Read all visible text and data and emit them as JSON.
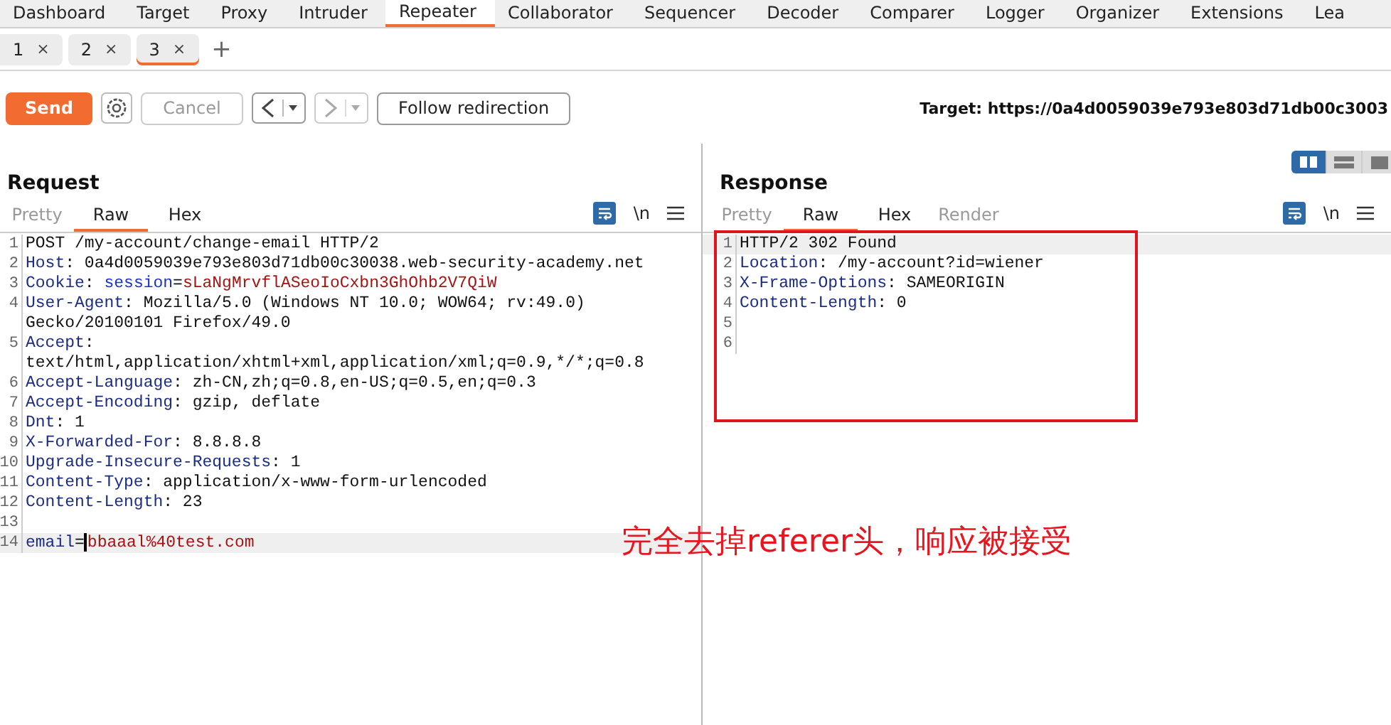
{
  "main_tabs": [
    {
      "label": "Dashboard",
      "selected": false
    },
    {
      "label": "Target",
      "selected": false
    },
    {
      "label": "Proxy",
      "selected": false
    },
    {
      "label": "Intruder",
      "selected": false
    },
    {
      "label": "Repeater",
      "selected": true
    },
    {
      "label": "Collaborator",
      "selected": false
    },
    {
      "label": "Sequencer",
      "selected": false
    },
    {
      "label": "Decoder",
      "selected": false
    },
    {
      "label": "Comparer",
      "selected": false
    },
    {
      "label": "Logger",
      "selected": false
    },
    {
      "label": "Organizer",
      "selected": false
    },
    {
      "label": "Extensions",
      "selected": false
    },
    {
      "label": "Lea",
      "selected": false
    }
  ],
  "request_tabs": [
    {
      "label": "1",
      "close": "×",
      "selected": false
    },
    {
      "label": "2",
      "close": "×",
      "selected": false
    },
    {
      "label": "3",
      "close": "×",
      "selected": true
    }
  ],
  "add_tab": "+",
  "toolbar": {
    "send": "Send",
    "cancel": "Cancel",
    "follow": "Follow redirection",
    "target": "Target: https://0a4d0059039e793e803d71db00c3003"
  },
  "request": {
    "title": "Request",
    "tabs": [
      {
        "label": "Pretty",
        "selected": false,
        "disabled": true
      },
      {
        "label": "Raw",
        "selected": true,
        "disabled": false
      },
      {
        "label": "Hex",
        "selected": false,
        "disabled": false
      }
    ],
    "newline": "\\n",
    "lines": [
      {
        "number": "1",
        "current": false,
        "parts": [
          {
            "kind": "plain",
            "text": "POST /my-account/change-email HTTP/2"
          }
        ]
      },
      {
        "number": "2",
        "current": false,
        "parts": [
          {
            "kind": "name",
            "text": "Host"
          },
          {
            "kind": "plain",
            "text": ": 0a4d0059039e793e803d71db00c30038.web-security-academy.net"
          }
        ]
      },
      {
        "number": "3",
        "current": false,
        "parts": [
          {
            "kind": "name",
            "text": "Cookie"
          },
          {
            "kind": "plain",
            "text": ": "
          },
          {
            "kind": "param",
            "text": "session"
          },
          {
            "kind": "plain",
            "text": "="
          },
          {
            "kind": "value",
            "text": "sLaNgMrvflASeoIoCxbn3GhOhb2V7QiW"
          }
        ]
      },
      {
        "number": "4",
        "current": false,
        "parts": [
          {
            "kind": "name",
            "text": "User-Agent"
          },
          {
            "kind": "plain",
            "text": ": Mozilla/5.0 (Windows NT 10.0; WOW64; rv:49.0)"
          }
        ]
      },
      {
        "current": false,
        "parts": [
          {
            "kind": "plain",
            "text": "Gecko/20100101 Firefox/49.0"
          }
        ]
      },
      {
        "number": "5",
        "current": false,
        "parts": [
          {
            "kind": "name",
            "text": "Accept"
          },
          {
            "kind": "plain",
            "text": ":"
          }
        ]
      },
      {
        "current": false,
        "parts": [
          {
            "kind": "plain",
            "text": "text/html,application/xhtml+xml,application/xml;q=0.9,*/*;q=0.8"
          }
        ]
      },
      {
        "number": "6",
        "current": false,
        "parts": [
          {
            "kind": "name",
            "text": "Accept-Language"
          },
          {
            "kind": "plain",
            "text": ": zh-CN,zh;q=0.8,en-US;q=0.5,en;q=0.3"
          }
        ]
      },
      {
        "number": "7",
        "current": false,
        "parts": [
          {
            "kind": "name",
            "text": "Accept-Encoding"
          },
          {
            "kind": "plain",
            "text": ": gzip, deflate"
          }
        ]
      },
      {
        "number": "8",
        "current": false,
        "parts": [
          {
            "kind": "name",
            "text": "Dnt"
          },
          {
            "kind": "plain",
            "text": ": 1"
          }
        ]
      },
      {
        "number": "9",
        "current": false,
        "parts": [
          {
            "kind": "name",
            "text": "X-Forwarded-For"
          },
          {
            "kind": "plain",
            "text": ": 8.8.8.8"
          }
        ]
      },
      {
        "number": "10",
        "current": false,
        "parts": [
          {
            "kind": "name",
            "text": "Upgrade-Insecure-Requests"
          },
          {
            "kind": "plain",
            "text": ": 1"
          }
        ]
      },
      {
        "number": "11",
        "current": false,
        "parts": [
          {
            "kind": "name",
            "text": "Content-Type"
          },
          {
            "kind": "plain",
            "text": ": application/x-www-form-urlencoded"
          }
        ]
      },
      {
        "number": "12",
        "current": false,
        "parts": [
          {
            "kind": "name",
            "text": "Content-Length"
          },
          {
            "kind": "plain",
            "text": ": 23"
          }
        ]
      },
      {
        "number": "13",
        "current": false
      },
      {
        "number": "14",
        "current": true,
        "parts": [
          {
            "kind": "name",
            "text": "email"
          },
          {
            "kind": "plain",
            "text": "="
          },
          {
            "kind": "value",
            "text": "bbaaal%40test.com"
          }
        ]
      }
    ]
  },
  "response": {
    "title": "Response",
    "tabs": [
      {
        "label": "Pretty",
        "selected": false,
        "disabled": true
      },
      {
        "label": "Raw",
        "selected": true,
        "disabled": false
      },
      {
        "label": "Hex",
        "selected": false,
        "disabled": false
      },
      {
        "label": "Render",
        "selected": false,
        "disabled": true
      }
    ],
    "newline": "\\n",
    "layout_buttons": [
      {
        "kind": "columns",
        "selected": true
      },
      {
        "kind": "rows",
        "selected": false
      },
      {
        "kind": "single",
        "selected": false
      }
    ],
    "lines": [
      {
        "number": "1",
        "current": true,
        "parts": [
          {
            "kind": "plain",
            "text": "HTTP/2 302 Found"
          }
        ]
      },
      {
        "number": "2",
        "current": false,
        "parts": [
          {
            "kind": "name",
            "text": "Location"
          },
          {
            "kind": "plain",
            "text": ": /my-account?id=wiener"
          }
        ]
      },
      {
        "number": "3",
        "current": false,
        "parts": [
          {
            "kind": "name",
            "text": "X-Frame-Options"
          },
          {
            "kind": "plain",
            "text": ": SAMEORIGIN"
          }
        ]
      },
      {
        "number": "4",
        "current": false,
        "parts": [
          {
            "kind": "name",
            "text": "Content-Length"
          },
          {
            "kind": "plain",
            "text": ": 0"
          }
        ]
      },
      {
        "number": "5",
        "current": false
      },
      {
        "number": "6",
        "current": false
      }
    ]
  },
  "annotation": "完全去掉referer头，响应被接受"
}
